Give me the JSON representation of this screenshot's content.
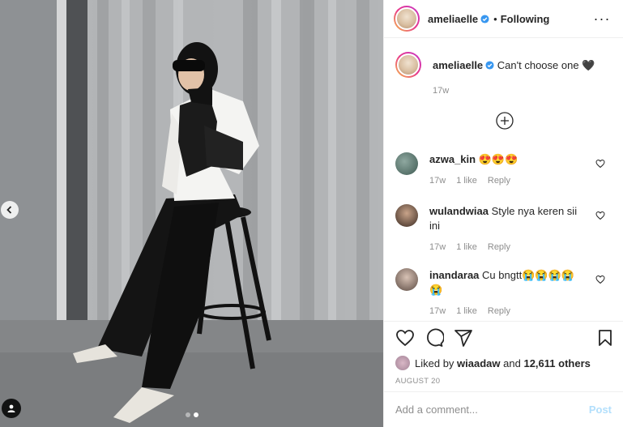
{
  "author": {
    "username": "ameliaelle",
    "bullet": "•",
    "follow_status": "Following"
  },
  "caption": {
    "text": "Can't choose one",
    "emoji": "🖤",
    "time": "17w"
  },
  "comments": [
    {
      "username": "azwa_kin",
      "text": "😍😍😍",
      "time": "17w",
      "likes": "1 like",
      "reply": "Reply"
    },
    {
      "username": "wulandwiaa",
      "text": "Style nya keren sii ini",
      "time": "17w",
      "likes": "1 like",
      "reply": "Reply"
    },
    {
      "username": "inandaraa",
      "text": "Cu bngtt😭😭😭😭😭",
      "time": "17w",
      "likes": "1 like",
      "reply": "Reply"
    }
  ],
  "likes": {
    "prefix": "Liked by",
    "user": "wiaadaw",
    "joiner": "and",
    "others": "12,611 others"
  },
  "date": "AUGUST 20",
  "composer": {
    "placeholder": "Add a comment...",
    "post_label": "Post"
  },
  "carousel": {
    "total": 2,
    "active": 1
  },
  "colors": {
    "verified": "#3897f0",
    "post_button": "#b2dffc",
    "muted_text": "#8e8e8e",
    "border": "#efefef"
  },
  "icons": [
    "chevron-left-icon",
    "user-tag-icon",
    "verified-badge-icon",
    "more-options-icon",
    "plus-circle-icon",
    "heart-icon",
    "comment-icon",
    "share-icon",
    "bookmark-icon"
  ]
}
